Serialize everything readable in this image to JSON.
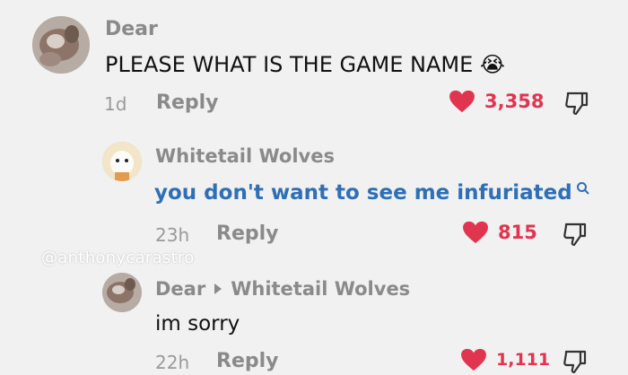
{
  "comments": [
    {
      "username": "Dear",
      "text": "PLEASE WHAT IS THE GAME NAME",
      "emoji": "😭",
      "time": "1d",
      "reply_label": "Reply",
      "likes": "3,358"
    },
    {
      "username": "Whitetail Wolves",
      "text": "you don't want to see me infuriated",
      "time": "23h",
      "reply_label": "Reply",
      "likes": "815"
    },
    {
      "username": "Dear",
      "reply_to": "Whitetail Wolves",
      "text": "im sorry",
      "time": "22h",
      "reply_label": "Reply",
      "likes": "1,111"
    }
  ],
  "watermark": "@anthonycarastro",
  "colors": {
    "accent_red": "#e0344f",
    "search_blue": "#2e6fb5",
    "muted": "#8a8a8a"
  },
  "icons": [
    "heart-icon",
    "dislike-icon",
    "search-icon",
    "chevron-right-icon"
  ]
}
